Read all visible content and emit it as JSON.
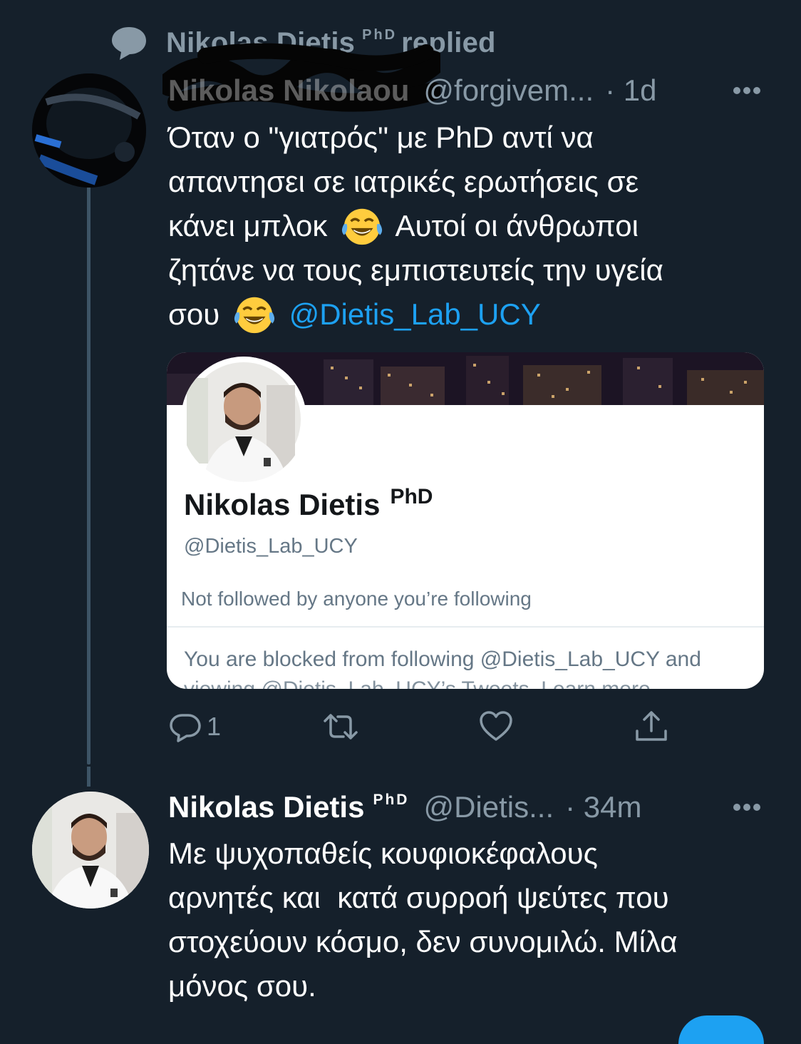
{
  "reply_context": {
    "name": "Nikolas Dietis",
    "sup": "PhD",
    "action": "replied"
  },
  "tweet1": {
    "name": "Nikolas Nikolaou",
    "handle": "@forgivem...",
    "time": "· 1d",
    "text_lines": [
      "Όταν ο \"γιατρός\" με PhD αντί να",
      "απαντησει σε ιατρικές ερωτήσεις σε",
      "κάνει μπλοκ",
      "Αυτοί οι άνθρωποι",
      "ζητάνε να τους εμπιστευτείς την υγεία",
      "σου"
    ],
    "mention": "@Dietis_Lab_UCY",
    "emoji": "face-with-tears-of-joy",
    "embedded_card": {
      "name": "Nikolas Dietis",
      "sup": "PhD",
      "handle": "@Dietis_Lab_UCY",
      "follow_status": "Not followed by anyone you’re following",
      "blocked_line1": "You are blocked from following @Dietis_Lab_UCY and",
      "blocked_line2": "viewing @Dietis_Lab_UCY’s Tweets. Learn more"
    },
    "actions": {
      "reply_count": "1",
      "icons": [
        "reply-icon",
        "retweet-icon",
        "like-icon",
        "share-icon"
      ]
    }
  },
  "tweet2": {
    "name": "Nikolas Dietis",
    "sup": "PhD",
    "handle": "@Dietis...",
    "time": "· 34m",
    "text_lines": [
      "Με ψυχοπαθείς κουφιοκέφαλους",
      "αρνητές και  κατά συρροή ψεύτες που",
      "στοχεύουν κόσμο, δεν συνομιλώ. Μίλα",
      "μόνος σου."
    ]
  },
  "colors": {
    "background": "#15202b",
    "secondary_text": "#8899a6",
    "accent": "#1da1f2",
    "thread_line": "#3d5466"
  }
}
